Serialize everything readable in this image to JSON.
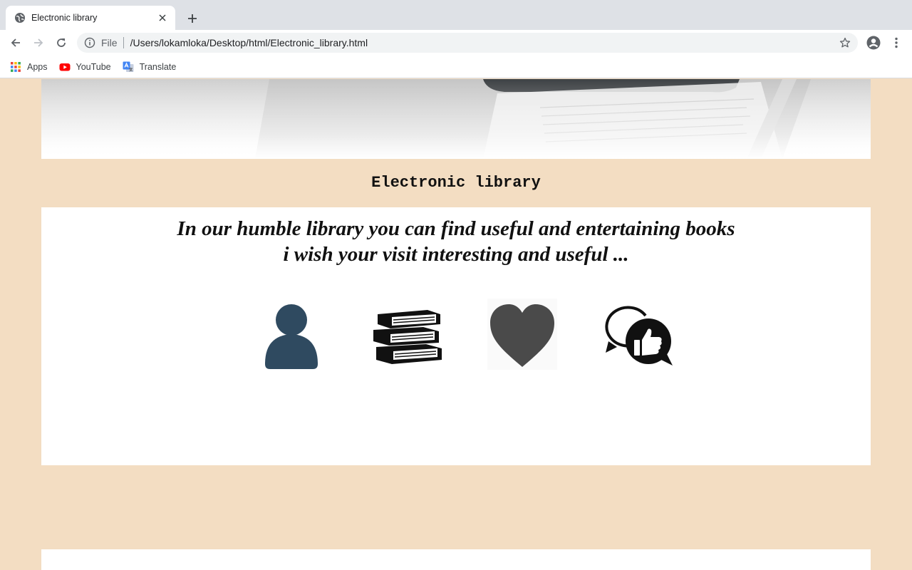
{
  "browser": {
    "tab_title": "Electronic library",
    "address_scheme": "File",
    "address_url": "/Users/lokamloka/Desktop/html/Electronic_library.html",
    "bookmarks": [
      {
        "label": "Apps",
        "icon": "apps-grid-icon"
      },
      {
        "label": "YouTube",
        "icon": "youtube-icon"
      },
      {
        "label": "Translate",
        "icon": "google-translate-icon"
      }
    ]
  },
  "page": {
    "heading": "Electronic library",
    "tagline_line1": "In our humble library you can find useful and entertaining books",
    "tagline_line2": "i wish your visit interesting and useful ...",
    "feature_icons": [
      "user-icon",
      "books-icon",
      "heart-icon",
      "chat-like-icon"
    ]
  },
  "colors": {
    "page_background": "#f3ddc2",
    "card_background": "#ffffff",
    "user_icon": "#2f4a60",
    "heart_icon": "#4a4a4a"
  }
}
